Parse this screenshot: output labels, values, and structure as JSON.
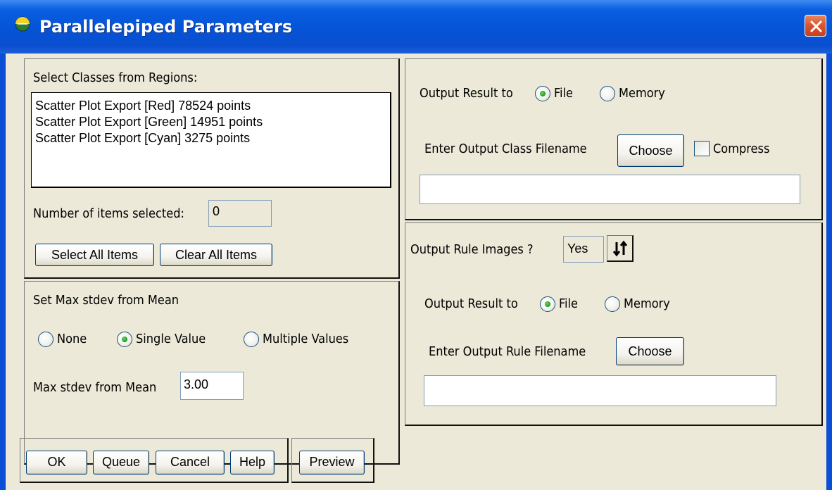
{
  "window": {
    "title": "Parallelepiped Parameters",
    "titlebar_color": "#0553d6",
    "icon": "envi-app-icon",
    "close_icon": "close-x-icon"
  },
  "classes": {
    "heading": "Select Classes from Regions:",
    "items": [
      "Scatter Plot Export [Red] 78524 points",
      "Scatter Plot Export [Green] 14951 points",
      "Scatter Plot Export [Cyan] 3275 points"
    ],
    "count_label": "Number of items selected:",
    "count_value": "0",
    "select_all_label": "Select All Items",
    "clear_all_label": "Clear All Items"
  },
  "stdev": {
    "heading": "Set Max stdev from Mean",
    "options": [
      "None",
      "Single Value",
      "Multiple Values"
    ],
    "selected": "Single Value",
    "value_label": "Max stdev from Mean",
    "value": "3.00"
  },
  "output_class": {
    "result_label": "Output Result to",
    "file_label": "File",
    "memory_label": "Memory",
    "selected": "File",
    "filename_label": "Enter Output Class Filename",
    "choose_label": "Choose",
    "compress_label": "Compress",
    "compress_checked": false,
    "filename_value": ""
  },
  "output_rule": {
    "images_label": "Output Rule Images ?",
    "images_value": "Yes",
    "toggle_icon": "swap-arrows-icon",
    "result_label": "Output Result to",
    "file_label": "File",
    "memory_label": "Memory",
    "selected": "File",
    "filename_label": "Enter Output Rule Filename",
    "choose_label": "Choose",
    "filename_value": ""
  },
  "footer": {
    "ok_label": "OK",
    "queue_label": "Queue",
    "cancel_label": "Cancel",
    "help_label": "Help",
    "preview_label": "Preview"
  }
}
